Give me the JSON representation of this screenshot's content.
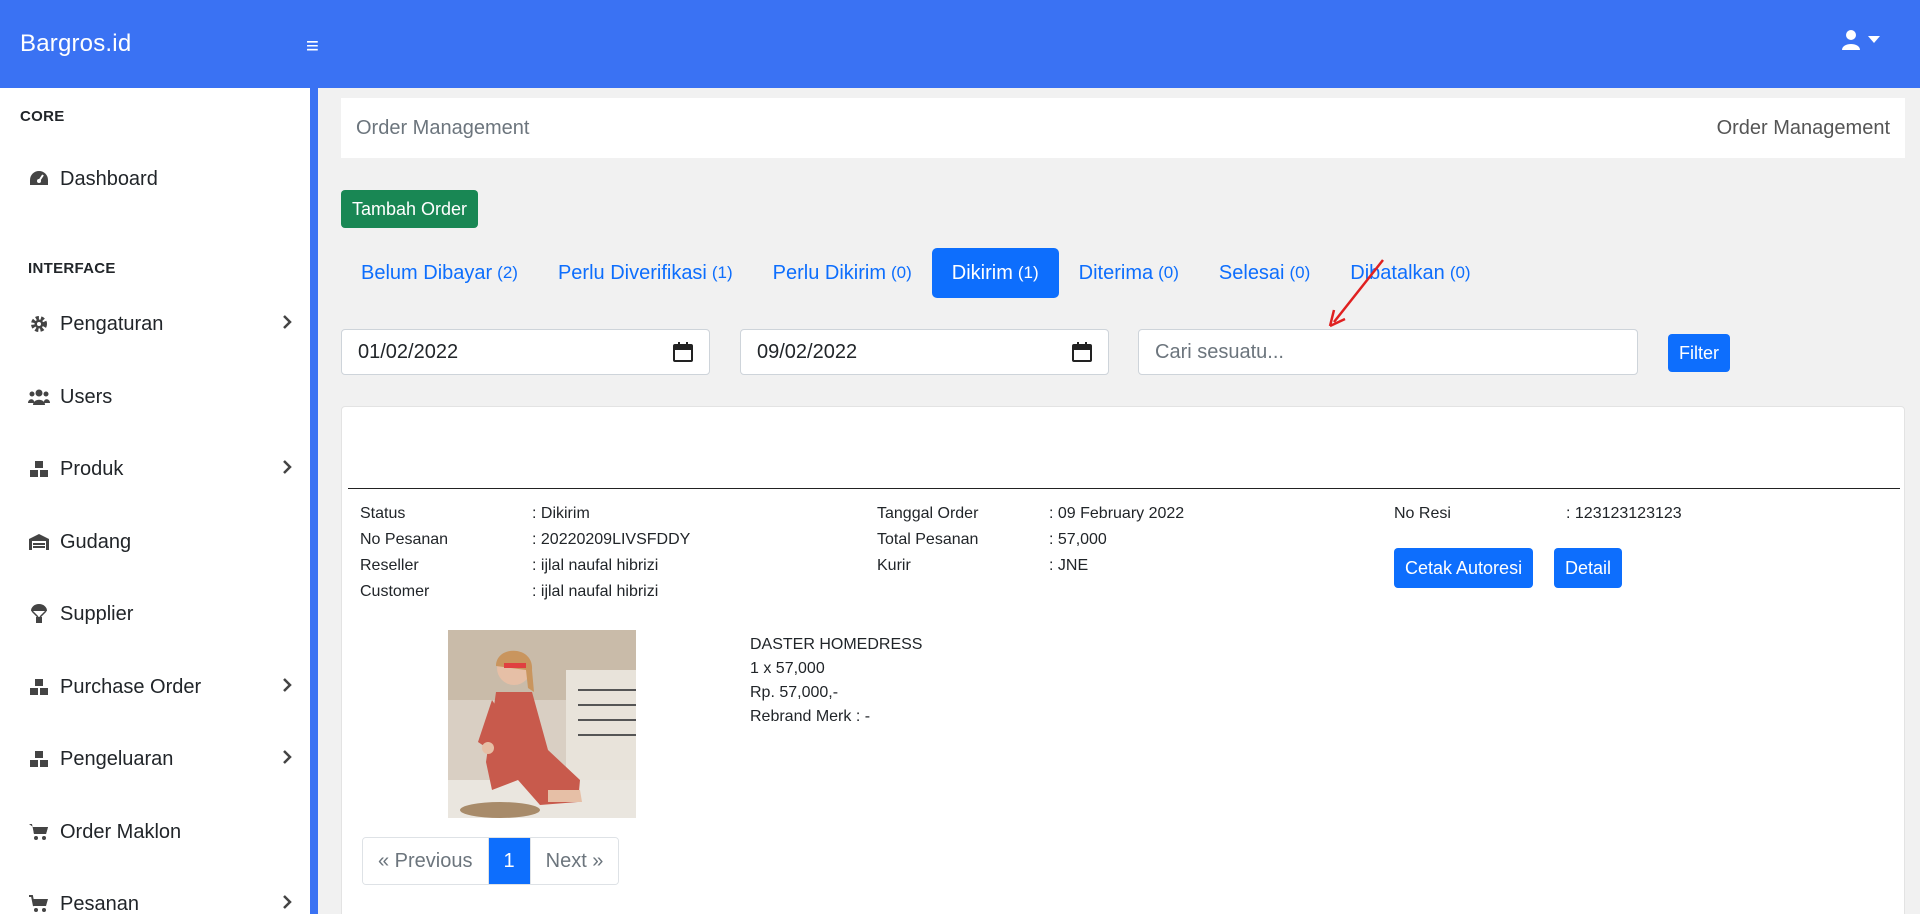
{
  "app": {
    "brand": "Bargros.id"
  },
  "sidebar": {
    "headings": {
      "core": "CORE",
      "interface": "INTERFACE"
    },
    "items": [
      {
        "label": "Dashboard",
        "icon": "gauge-icon",
        "submenu": false
      },
      {
        "label": "Pengaturan",
        "icon": "gear-icon",
        "submenu": true
      },
      {
        "label": "Users",
        "icon": "users-icon",
        "submenu": false
      },
      {
        "label": "Produk",
        "icon": "boxes-icon",
        "submenu": true
      },
      {
        "label": "Gudang",
        "icon": "warehouse-icon",
        "submenu": false
      },
      {
        "label": "Supplier",
        "icon": "parachute-box-icon",
        "submenu": false
      },
      {
        "label": "Purchase Order",
        "icon": "boxes-icon",
        "submenu": true
      },
      {
        "label": "Pengeluaran",
        "icon": "boxes-icon",
        "submenu": true
      },
      {
        "label": "Order Maklon",
        "icon": "cart-icon",
        "submenu": false
      },
      {
        "label": "Pesanan",
        "icon": "cart-icon",
        "submenu": true
      }
    ]
  },
  "page": {
    "breadcrumb_left": "Order Management",
    "breadcrumb_right": "Order Management",
    "add_button": "Tambah Order"
  },
  "tabs": [
    {
      "label": "Belum Dibayar",
      "count": "(2)",
      "active": false
    },
    {
      "label": "Perlu Diverifikasi",
      "count": "(1)",
      "active": false
    },
    {
      "label": "Perlu Dikirim",
      "count": "(0)",
      "active": false
    },
    {
      "label": "Dikirim",
      "count": "(1)",
      "active": true
    },
    {
      "label": "Diterima",
      "count": "(0)",
      "active": false
    },
    {
      "label": "Selesai",
      "count": "(0)",
      "active": false
    },
    {
      "label": "Dibatalkan",
      "count": "(0)",
      "active": false
    }
  ],
  "filters": {
    "start_date": "01/02/2022",
    "end_date": "09/02/2022",
    "search_placeholder": "Cari sesuatu...",
    "filter_button": "Filter"
  },
  "order": {
    "col1": [
      {
        "label": "Status",
        "value": ": Dikirim"
      },
      {
        "label": "No Pesanan",
        "value": ": 20220209LIVSFDDY"
      },
      {
        "label": "Reseller",
        "value": ": ijlal naufal hibrizi"
      },
      {
        "label": "Customer",
        "value": ": ijlal naufal hibrizi"
      }
    ],
    "col2": [
      {
        "label": "Tanggal Order",
        "value": ": 09 February 2022"
      },
      {
        "label": "Total Pesanan",
        "value": ": 57,000"
      },
      {
        "label": "Kurir",
        "value": ": JNE"
      }
    ],
    "col3": [
      {
        "label": "No Resi",
        "value": ": 123123123123"
      }
    ],
    "buttons": {
      "print": "Cetak Autoresi",
      "detail": "Detail"
    },
    "product": {
      "name": "DASTER HOMEDRESS",
      "qty_price": "1 x 57,000",
      "subtotal": "Rp. 57,000,-",
      "rebrand": "Rebrand Merk : -"
    }
  },
  "pagination": {
    "prev": "« Previous",
    "current": "1",
    "next": "Next »"
  },
  "colors": {
    "primary": "#0d6efd",
    "topbar": "#3a72f3",
    "success": "#198754",
    "annotation": "#e02020"
  }
}
